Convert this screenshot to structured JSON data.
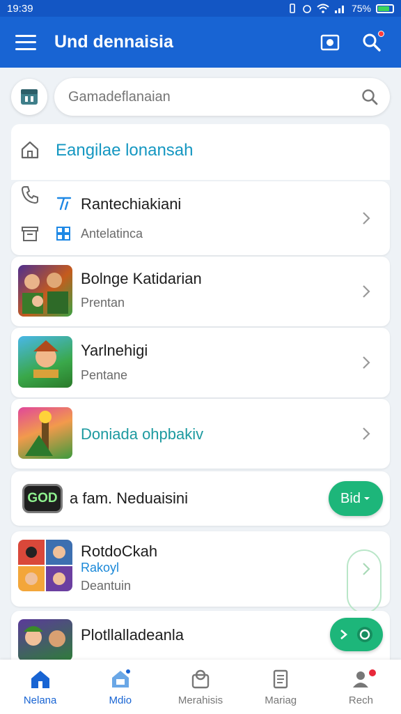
{
  "status_bar": {
    "time": "19:39",
    "battery": "75%"
  },
  "app_bar": {
    "title": "Und dennaisia"
  },
  "search": {
    "placeholder": "Gamadeflanaian"
  },
  "home_section": {
    "title": "Eangilae lonansah"
  },
  "items": [
    {
      "title": "Rantechiakiani",
      "subtitle": "Antelatinca"
    },
    {
      "title": "Bolnge Katidarian",
      "subtitle": "Prentan"
    },
    {
      "title": "Yarlnehigi",
      "subtitle": "Pentane"
    },
    {
      "title": "Doniada ohpbakiv"
    },
    {
      "badge": "GOD",
      "title": "a fam. Neduaisini",
      "button": "Bid"
    },
    {
      "title": "RotdoCkah",
      "tag": "Rakoyl",
      "subtitle": "Deantuin"
    },
    {
      "title": "Plotllalladeanla"
    }
  ],
  "bottom_nav": [
    {
      "label": "Nelana",
      "icon": "home-icon",
      "active": true
    },
    {
      "label": "Mdio",
      "icon": "store-icon"
    },
    {
      "label": "Merahisis",
      "icon": "badge-icon"
    },
    {
      "label": "Mariag",
      "icon": "document-icon"
    },
    {
      "label": "Rech",
      "icon": "profile-icon"
    }
  ],
  "colors": {
    "primary": "#1864d3",
    "accent_teal": "#1597c1",
    "cta_green": "#1db67a"
  }
}
